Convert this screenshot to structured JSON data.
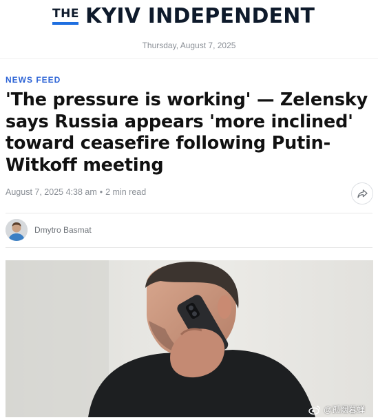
{
  "masthead": {
    "logo_prefix": "THE",
    "logo_name": "KYIV INDEPENDENT",
    "accent_color": "#1f6fe0"
  },
  "dateline": "Thursday, August 7, 2025",
  "article": {
    "category": "NEWS FEED",
    "category_color": "#2d64d6",
    "headline": "'The pressure is working' — Zelensky says Russia appears 'more inclined' toward ceasefire following Putin-Witkoff meeting",
    "published": "August 7, 2025 4:38 am",
    "separator": "•",
    "read_time": "2 min read",
    "share_icon": "share-arrow-icon",
    "author": "Dmytro Basmat"
  },
  "watermark": {
    "icon": "weibo-icon",
    "text": "@孤烟暮蝉"
  }
}
